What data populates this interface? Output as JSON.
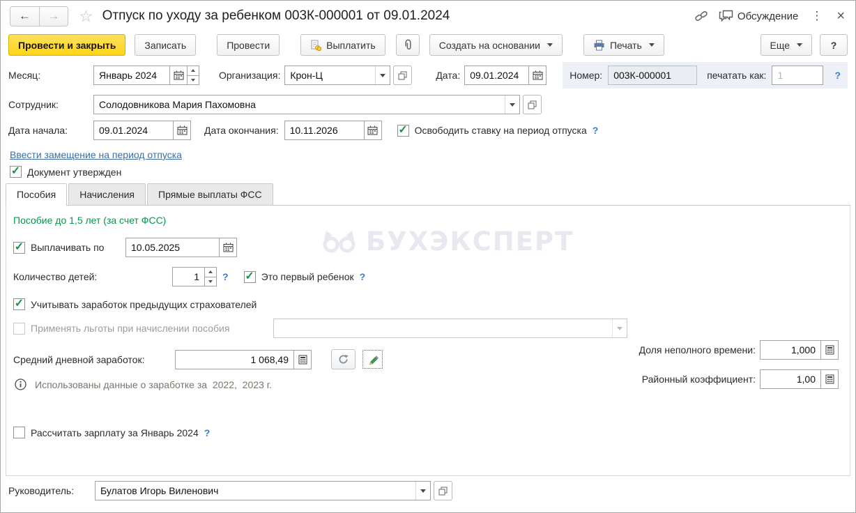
{
  "icons": {
    "back": "←",
    "forward": "→",
    "star": "☆",
    "more_dots": "⋮",
    "close": "×"
  },
  "ui": {
    "help": "?"
  },
  "header": {
    "title": "Отпуск по уходу за ребенком 003К-000001 от 09.01.2024",
    "discussion": "Обсуждение"
  },
  "toolbar": {
    "post_and_close": "Провести и закрыть",
    "save": "Записать",
    "post": "Провести",
    "pay": "Выплатить",
    "create_based_on": "Создать на основании",
    "print": "Печать",
    "more": "Еще",
    "help": "?"
  },
  "fields": {
    "month": {
      "label": "Месяц:",
      "value": "Январь 2024"
    },
    "organization": {
      "label": "Организация:",
      "value": "Крон-Ц"
    },
    "date": {
      "label": "Дата:",
      "value": "09.01.2024"
    },
    "number": {
      "label": "Номер:",
      "value": "003К-000001"
    },
    "print_as": {
      "label": "печатать как:",
      "value": "1"
    },
    "employee": {
      "label": "Сотрудник:",
      "value": "Солодовникова Мария Пахомовна"
    },
    "date_start": {
      "label": "Дата начала:",
      "value": "09.01.2024"
    },
    "date_end": {
      "label": "Дата окончания:",
      "value": "10.11.2026"
    },
    "release_rate": {
      "label": "Освободить ставку на период отпуска",
      "checked": true
    },
    "substitution_link": "Ввести замещение на период отпуска",
    "approved": {
      "label": "Документ утвержден",
      "checked": true
    },
    "manager": {
      "label": "Руководитель:",
      "value": "Булатов Игорь Виленович"
    }
  },
  "tabs": [
    {
      "label": "Пособия",
      "active": true
    },
    {
      "label": "Начисления",
      "active": false
    },
    {
      "label": "Прямые выплаты ФСС",
      "active": false
    }
  ],
  "benefits": {
    "section_title": "Пособие до 1,5 лет (за счет ФСС)",
    "pay_until": {
      "label": "Выплачивать по",
      "value": "10.05.2025",
      "checked": true
    },
    "children_count": {
      "label": "Количество детей:",
      "value": "1"
    },
    "first_child": {
      "label": "Это первый ребенок",
      "checked": true
    },
    "prior_insurers": {
      "label": "Учитывать заработок предыдущих страхователей",
      "checked": true
    },
    "apply_privileges": {
      "label": "Применять льготы при начислении пособия",
      "checked": false,
      "value": ""
    },
    "avg_daily_earnings": {
      "label": "Средний дневной заработок:",
      "value": "1 068,49"
    },
    "part_time_share": {
      "label": "Доля неполного времени:",
      "value": "1,000"
    },
    "district_coefficient": {
      "label": "Районный коэффициент:",
      "value": "1,00"
    },
    "earnings_note": "Использованы данные о заработке за  2022,  2023 г.",
    "calc_salary": {
      "label": "Рассчитать зарплату за Январь 2024",
      "checked": false
    }
  },
  "watermark": {
    "text": "БУХЭКСПЕРТ"
  }
}
